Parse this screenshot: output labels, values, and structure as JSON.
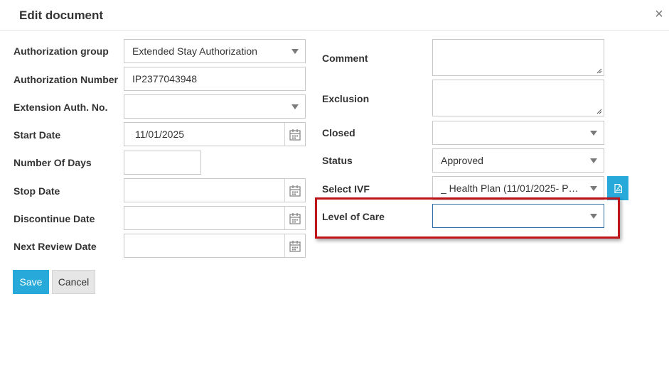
{
  "dialog": {
    "title": "Edit document",
    "close_glyph": "×"
  },
  "left": {
    "authorization_group": {
      "label": "Authorization group",
      "value": "Extended Stay Authorization"
    },
    "authorization_number": {
      "label": "Authorization Number",
      "value": "IP2377043948"
    },
    "extension_auth_no": {
      "label": "Extension Auth. No.",
      "value": ""
    },
    "start_date": {
      "label": "Start Date",
      "value": "11/01/2025"
    },
    "number_of_days": {
      "label": "Number Of Days",
      "value": ""
    },
    "stop_date": {
      "label": "Stop Date",
      "value": ""
    },
    "discontinue_date": {
      "label": "Discontinue Date",
      "value": ""
    },
    "next_review_date": {
      "label": "Next Review Date",
      "value": ""
    }
  },
  "right": {
    "comment": {
      "label": "Comment",
      "value": ""
    },
    "exclusion": {
      "label": "Exclusion",
      "value": ""
    },
    "closed": {
      "label": "Closed",
      "value": ""
    },
    "status": {
      "label": "Status",
      "value": "Approved"
    },
    "select_ivf": {
      "label": "Select IVF",
      "value": "_ Health Plan (11/01/2025- Pri…"
    },
    "level_of_care": {
      "label": "Level of Care",
      "value": ""
    }
  },
  "buttons": {
    "save": "Save",
    "cancel": "Cancel"
  },
  "icons": {
    "calendar": "calendar-icon",
    "pdf": "pdf-icon",
    "caret": "caret-down-icon"
  },
  "colors": {
    "primary": "#27a9d9",
    "highlight_border": "#c0141b",
    "focus_border": "#2e6da4"
  }
}
